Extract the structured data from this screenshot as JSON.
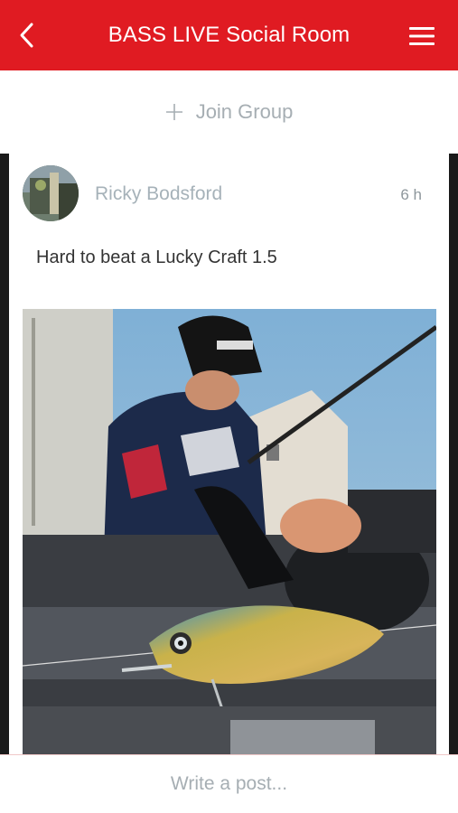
{
  "header": {
    "title": "BASS LIVE Social Room",
    "back_icon": "chevron-left-icon",
    "menu_icon": "hamburger-menu-icon",
    "background_color": "#e01b22"
  },
  "group": {
    "join_label": "Join Group",
    "join_icon": "plus-icon"
  },
  "post": {
    "author": "Ricky Bodsford",
    "time": "6 h",
    "text": "Hard to beat a Lucky Craft 1.5",
    "image_subject": "crankbait-lure-photo"
  },
  "composer": {
    "placeholder": "Write a post..."
  }
}
